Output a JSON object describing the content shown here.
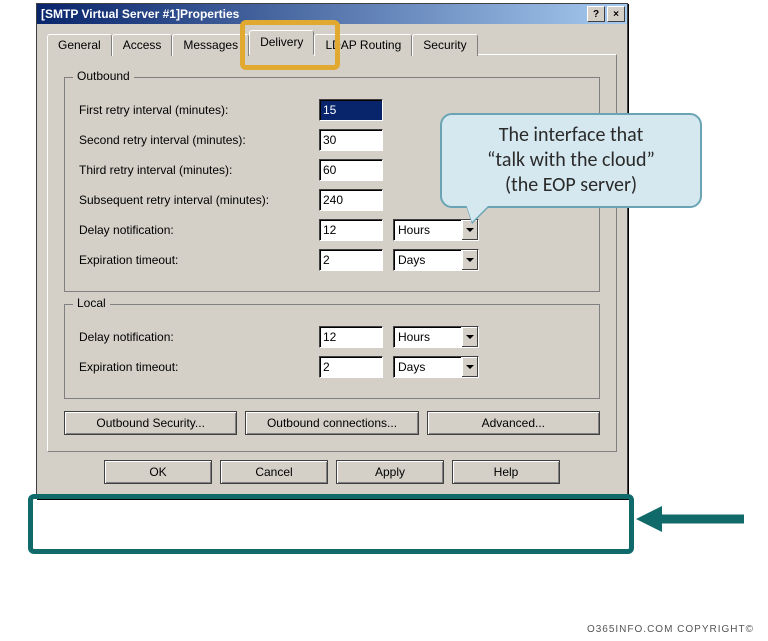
{
  "window": {
    "title_bold": "[SMTP Virtual Server #1]",
    "title_rest": " Properties",
    "help_icon": "?",
    "close_icon": "×"
  },
  "tabs": {
    "items": [
      "General",
      "Access",
      "Messages",
      "Delivery",
      "LDAP Routing",
      "Security"
    ],
    "active_index": 3
  },
  "outbound": {
    "legend": "Outbound",
    "rows": [
      {
        "label": "First retry interval (minutes):",
        "value": "15",
        "selected": true
      },
      {
        "label": "Second retry interval (minutes):",
        "value": "30"
      },
      {
        "label": "Third retry interval (minutes):",
        "value": "60"
      },
      {
        "label": "Subsequent retry interval (minutes):",
        "value": "240"
      },
      {
        "label": "Delay notification:",
        "value": "12",
        "unit": "Hours"
      },
      {
        "label": "Expiration timeout:",
        "value": "2",
        "unit": "Days"
      }
    ]
  },
  "local": {
    "legend": "Local",
    "rows": [
      {
        "label": "Delay notification:",
        "value": "12",
        "unit": "Hours"
      },
      {
        "label": "Expiration timeout:",
        "value": "2",
        "unit": "Days"
      }
    ]
  },
  "action_buttons": {
    "outbound_security": "Outbound Security...",
    "outbound_connections": "Outbound connections...",
    "advanced": "Advanced..."
  },
  "dialog_buttons": {
    "ok": "OK",
    "cancel": "Cancel",
    "apply": "Apply",
    "help": "Help"
  },
  "annotations": {
    "callout_line1": "The interface that",
    "callout_line2": "“talk with the cloud”",
    "callout_line3": "(the EOP server)",
    "arrow_color": "#106a6a"
  },
  "footer": "O365INFO.COM COPYRIGHT©"
}
